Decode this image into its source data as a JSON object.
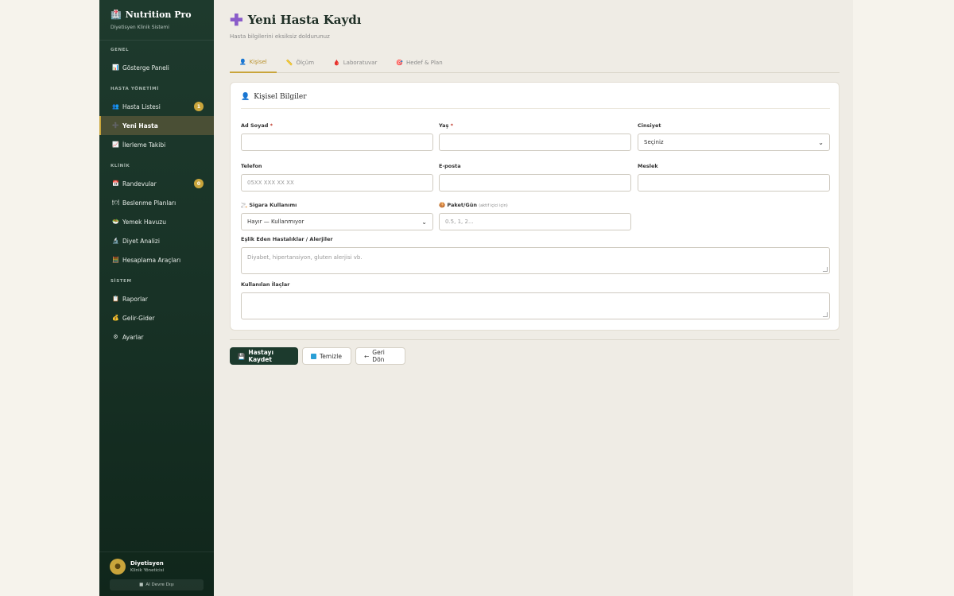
{
  "brand": {
    "icon": "🏥",
    "title": "Nutrition Pro",
    "subtitle": "Diyetisyen Klinik Sistemi"
  },
  "sidebar": {
    "sections": [
      {
        "label": "GENEL",
        "items": [
          {
            "icon": "📊",
            "label": "Gösterge Paneli",
            "active": false
          }
        ]
      },
      {
        "label": "HASTA YÖNETİMİ",
        "items": [
          {
            "icon": "👥",
            "label": "Hasta Listesi",
            "badge": "1",
            "active": false
          },
          {
            "icon": "➕",
            "label": "Yeni Hasta",
            "active": true
          },
          {
            "icon": "📈",
            "label": "İlerleme Takibi",
            "active": false
          }
        ]
      },
      {
        "label": "KLİNİK",
        "items": [
          {
            "icon": "📅",
            "label": "Randevular",
            "badge": "0",
            "active": false
          },
          {
            "icon": "🍽",
            "label": "Beslenme Planları",
            "active": false
          },
          {
            "icon": "🥗",
            "label": "Yemek Havuzu",
            "active": false
          },
          {
            "icon": "🔬",
            "label": "Diyet Analizi",
            "active": false
          },
          {
            "icon": "🧮",
            "label": "Hesaplama Araçları",
            "active": false
          }
        ]
      },
      {
        "label": "SİSTEM",
        "items": [
          {
            "icon": "📋",
            "label": "Raporlar",
            "active": false
          },
          {
            "icon": "💰",
            "label": "Gelir-Gider",
            "active": false
          },
          {
            "icon": "⚙",
            "label": "Ayarlar",
            "active": false
          }
        ]
      }
    ]
  },
  "user": {
    "name": "Diyetisyen",
    "role": "Klinik Yöneticisi",
    "logout_label": "AI Devre Dışı"
  },
  "page": {
    "icon": "✚",
    "title": "Yeni Hasta Kaydı",
    "subtitle": "Hasta bilgilerini eksiksiz doldurunuz"
  },
  "tabs": [
    {
      "icon": "👤",
      "label": "Kişisel",
      "active": true
    },
    {
      "icon": "📏",
      "label": "Ölçüm",
      "active": false
    },
    {
      "icon": "🩸",
      "label": "Laboratuvar",
      "active": false
    },
    {
      "icon": "🎯",
      "label": "Hedef & Plan",
      "active": false
    }
  ],
  "card": {
    "icon": "👤",
    "title": "Kişisel Bilgiler"
  },
  "form": {
    "ad_soyad": {
      "label": "Ad Soyad",
      "required": "*",
      "value": ""
    },
    "yas": {
      "label": "Yaş",
      "required": "*",
      "value": ""
    },
    "cinsiyet": {
      "label": "Cinsiyet",
      "selected": "Seçiniz"
    },
    "telefon": {
      "label": "Telefon",
      "placeholder": "05XX XXX XX XX"
    },
    "eposta": {
      "label": "E-posta",
      "placeholder": ""
    },
    "meslek": {
      "label": "Meslek",
      "placeholder": ""
    },
    "sigara": {
      "icon": "🚬",
      "label": "Sigara Kullanımı",
      "selected": "Hayır — Kullanmıyor"
    },
    "paket": {
      "icon": "🍪",
      "label": "Paket/Gün",
      "note": "(aktif içici için)",
      "placeholder": "0.5, 1, 2..."
    },
    "hastaliklar": {
      "label": "Eşlik Eden Hastalıklar / Alerjiler",
      "placeholder": "Diyabet, hipertansiyon, gluten alerjisi vb."
    },
    "ilaclar": {
      "label": "Kullanılan İlaçlar",
      "placeholder": ""
    }
  },
  "actions": {
    "save": {
      "icon": "💾",
      "label": "Hastayı Kaydet"
    },
    "clear": {
      "label": "Temizle"
    },
    "back": {
      "icon": "←",
      "label": "Geri Dön"
    }
  }
}
